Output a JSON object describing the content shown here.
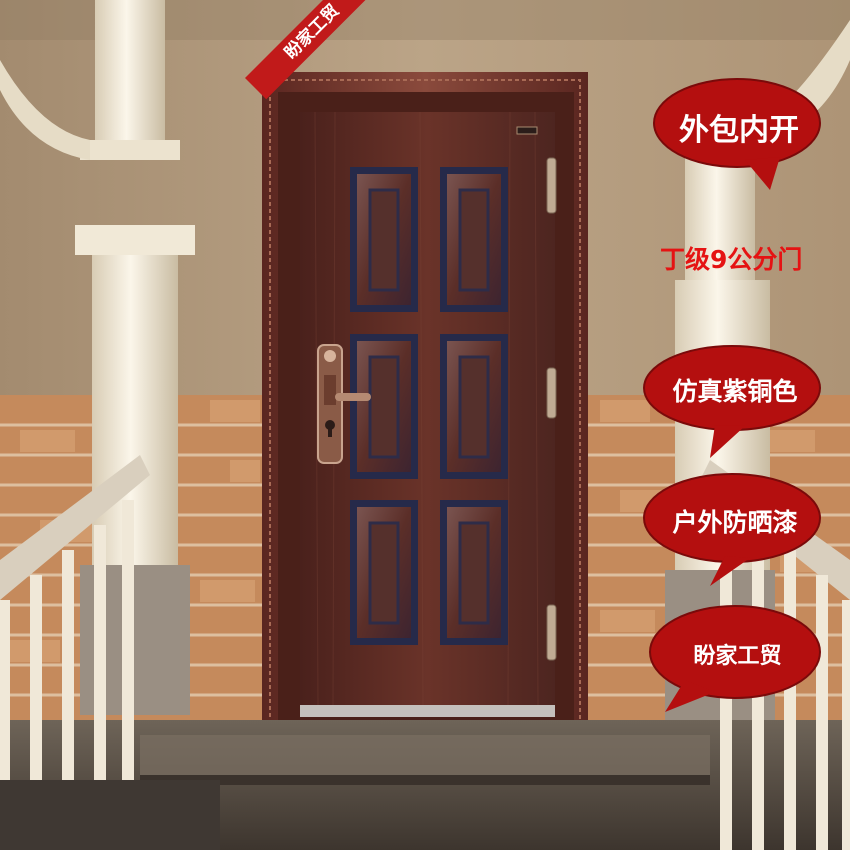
{
  "ribbon": {
    "label": "盼家工贸",
    "color": "#c11a1a"
  },
  "callouts": [
    {
      "label": "外包内开"
    },
    {
      "label": "仿真紫铜色"
    },
    {
      "label": "户外防晒漆"
    },
    {
      "label": "盼家工贸"
    }
  ],
  "spec": {
    "label": "丁级9公分门",
    "color": "#e51313"
  },
  "colors": {
    "bubble": "#b40f0f",
    "door": "#5a2a24",
    "frame": "#6a3028",
    "panel_edge": "#262a4a",
    "wall": "#b59f82",
    "brick": "#c58a5c"
  },
  "icons": [
    "door-handle-icon",
    "door-lock-icon",
    "door-hinge-icon"
  ]
}
